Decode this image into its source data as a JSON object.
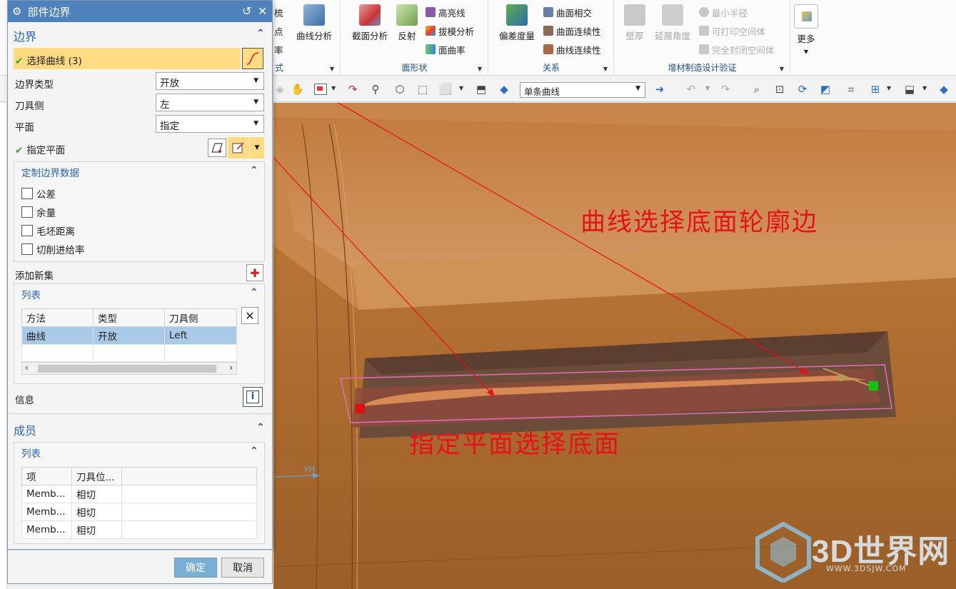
{
  "ribbon": {
    "partial_left": {
      "item1": "梳",
      "item2": "点",
      "item3": "率",
      "group_label_fragment": "式"
    },
    "curve_analysis": "曲线分析",
    "face_group": {
      "section_analysis": "截面分析",
      "reflection": "反射",
      "highlight": "高亮线",
      "draft_analysis": "拔模分析",
      "face_curvature": "面曲率",
      "label": "面形状"
    },
    "relation_group": {
      "deviation": "偏差度量",
      "face_intersect": "曲面相交",
      "face_continuity": "曲面连续性",
      "curve_continuity": "曲线连续性",
      "label": "关系"
    },
    "additive_group": {
      "wall_thickness": "壁厚",
      "extend_angle": "延展角度",
      "min_radius": "最小半径",
      "printable_space": "可打印空间体",
      "enclosed_space": "完全封闭空间体",
      "label": "增材制造设计验证"
    },
    "more": "更多"
  },
  "toolbar": {
    "selection_filter": "单条曲线"
  },
  "dialog": {
    "title": "部件边界",
    "boundary": {
      "header": "边界",
      "select_curve": "选择曲线 (3)",
      "boundary_type_label": "边界类型",
      "boundary_type_value": "开放",
      "tool_side_label": "刀具侧",
      "tool_side_value": "左",
      "plane_label": "平面",
      "plane_value": "指定",
      "specify_plane": "指定平面",
      "custom_data": {
        "header": "定制边界数据",
        "options": [
          "公差",
          "余量",
          "毛坯距离",
          "切削进给率"
        ]
      },
      "add_new_set": "添加新集",
      "list": {
        "header": "列表",
        "columns": [
          "方法",
          "类型",
          "刀具侧"
        ],
        "rows": [
          [
            "曲线",
            "开放",
            "Left"
          ]
        ]
      },
      "info": "信息"
    },
    "members": {
      "header": "成员",
      "list": {
        "header": "列表",
        "columns": [
          "项",
          "刀具位..."
        ],
        "rows": [
          [
            "Memb...",
            "相切"
          ],
          [
            "Memb...",
            "相切"
          ],
          [
            "Memb...",
            "相切"
          ]
        ]
      }
    },
    "ok": "确定",
    "cancel": "取消"
  },
  "viewport": {
    "annotation_curve": "曲线选择底面轮廓边",
    "annotation_plane": "指定平面选择底面",
    "axis_label": "YM",
    "watermark": "3D世界网",
    "watermark_url": "WWW.3DSJW.COM"
  },
  "colors": {
    "title_bar": "#4f81bd",
    "accent_text": "#2a67b0",
    "highlight_row": "#ffdb81",
    "selected_row": "#a9cae6",
    "ok_button": "#7aaed5",
    "model_orange": "#c8864a",
    "annotation_red": "#e8111a",
    "check_green": "#2da52d"
  },
  "icons": [
    "settings-gear-icon",
    "reset-icon",
    "close-icon",
    "collapse-icon",
    "curve-select-icon",
    "plane-dialog-icon",
    "plane-select-icon",
    "add-set-icon",
    "delete-icon",
    "info-icon",
    "check-icon"
  ]
}
